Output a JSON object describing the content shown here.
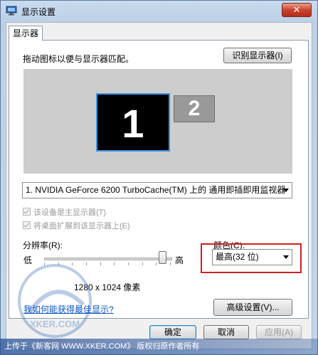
{
  "window": {
    "title": "显示设置",
    "close_label": "✕",
    "icon": "display-settings-icon"
  },
  "tabs": [
    {
      "label": "显示器",
      "selected": true
    }
  ],
  "monitor": {
    "instruction": "拖动图标以便与显示器匹配。",
    "identify_button": "识别显示器(I)",
    "displays": [
      {
        "number": "1",
        "selected": true
      },
      {
        "number": "2",
        "selected": false
      }
    ],
    "device_select": "1. NVIDIA GeForce 6200 TurboCache(TM) 上的 通用即插即用监视器",
    "primary_checkbox": "该设备是主显示器(T)",
    "extend_checkbox": "将桌面扩展到该显示器上(E)"
  },
  "resolution": {
    "label": "分辨率(R):",
    "low": "低",
    "high": "高",
    "value": "1280 x 1024 像素",
    "slider_level": 1.0
  },
  "color": {
    "label": "颜色(C):",
    "value": "最高(32 位)"
  },
  "link": "我如何能获得最佳显示?",
  "advanced_button": "高级设置(V)...",
  "footer": {
    "ok": "确定",
    "cancel": "取消",
    "apply": "应用(A)"
  },
  "watermark": {
    "text": "上传于《新客网 WWW.XKER.COM》 版权归原作者所有",
    "logo_text": "XKER.COM"
  },
  "colors": {
    "highlight_border": "#d21f1f",
    "link": "#0b55c4",
    "selected_monitor_border": "#3a92e4"
  }
}
